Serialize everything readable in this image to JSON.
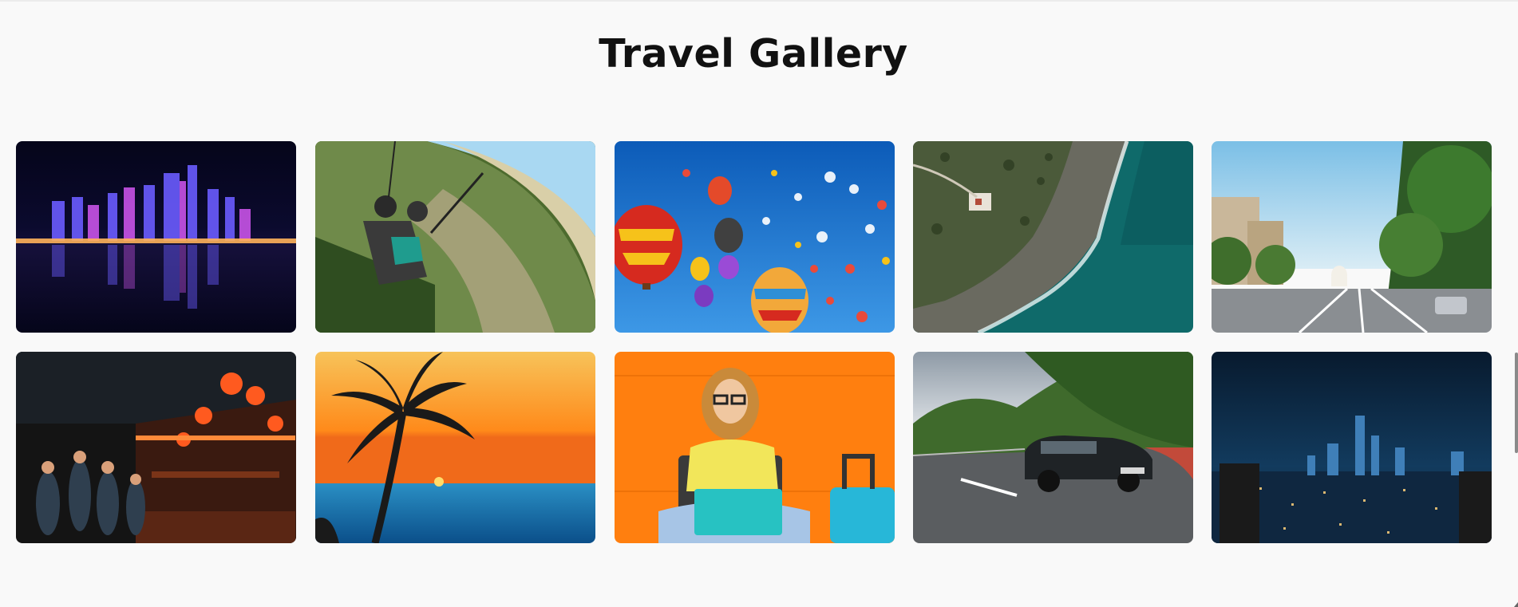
{
  "page": {
    "title": "Travel Gallery"
  },
  "gallery": {
    "items": [
      {
        "name": "city-night-skyline"
      },
      {
        "name": "paragliding-tandem"
      },
      {
        "name": "hot-air-balloons"
      },
      {
        "name": "aerial-coastline"
      },
      {
        "name": "city-street-capitol"
      },
      {
        "name": "night-market"
      },
      {
        "name": "palm-sunset"
      },
      {
        "name": "woman-laptop-suitcase"
      },
      {
        "name": "car-mountain-road"
      },
      {
        "name": "city-night-towers"
      }
    ]
  }
}
